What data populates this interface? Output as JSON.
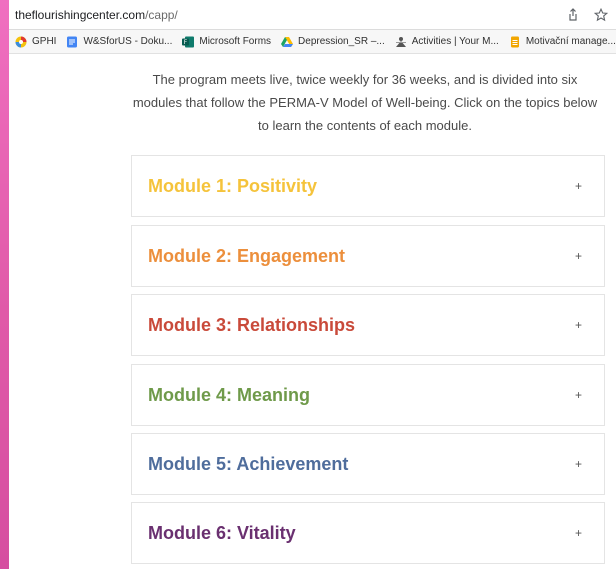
{
  "browser": {
    "url_host": "theflourishingcenter.com",
    "url_path": "/capp/",
    "share_icon": "share-icon",
    "star_icon": "star-icon"
  },
  "bookmarks": [
    {
      "label": "GPHI",
      "icon": "gphi-icon",
      "color": "#e0382e"
    },
    {
      "label": "W&SforUS - Doku...",
      "icon": "docs-icon",
      "color": "#4285f4"
    },
    {
      "label": "Microsoft Forms",
      "icon": "forms-icon",
      "color": "#0f7b6c"
    },
    {
      "label": "Depression_SR –...",
      "icon": "drive-icon",
      "color": "#fbbc04"
    },
    {
      "label": "Activities | Your M...",
      "icon": "activities-icon",
      "color": "#6b6b6b"
    },
    {
      "label": "Motivační manage...",
      "icon": "sheets-icon",
      "color": "#f2a600"
    }
  ],
  "intro": {
    "text": "The program meets live, twice weekly for 36 weeks, and is divided into six modules that follow the PERMA-V Model of Well-being. Click on the topics below to learn the contents of each module."
  },
  "modules": [
    {
      "title": "Module 1: Positivity",
      "color": "#f5c33b",
      "toggle": "+"
    },
    {
      "title": "Module 2: Engagement",
      "color": "#ec8f3c",
      "toggle": "+"
    },
    {
      "title": "Module 3: Relationships",
      "color": "#c94a3a",
      "toggle": "+"
    },
    {
      "title": "Module 4: Meaning",
      "color": "#6f9a4a",
      "toggle": "+"
    },
    {
      "title": "Module 5: Achievement",
      "color": "#4f6d9c",
      "toggle": "+"
    },
    {
      "title": "Module 6: Vitality",
      "color": "#6a3070",
      "toggle": "+"
    }
  ]
}
